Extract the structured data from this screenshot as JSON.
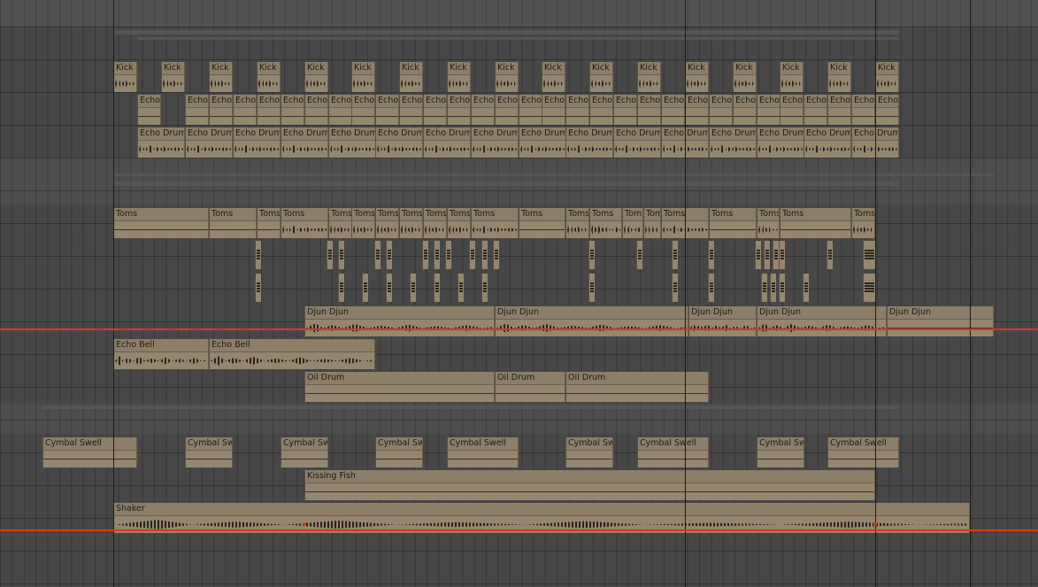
{
  "tracks": {
    "kick": {
      "label": "Kick"
    },
    "echo_a": {
      "label": "Echo"
    },
    "echo_drum": {
      "label": "Echo Drum"
    },
    "toms": {
      "label": "Toms"
    },
    "djun": {
      "label": "Djun Djun"
    },
    "echo_bell": {
      "label": "Echo Bell"
    },
    "oil": {
      "label": "Oil Drum"
    },
    "cymbal": {
      "label": "Cymbal Swell"
    },
    "kissing": {
      "label": "Kissing Fish"
    },
    "shaker": {
      "label": "Shaker"
    }
  },
  "colors": {
    "clip": "#94866f",
    "clip_header": "#8c7e67",
    "automation": "#e0341f",
    "background": "#474747"
  }
}
